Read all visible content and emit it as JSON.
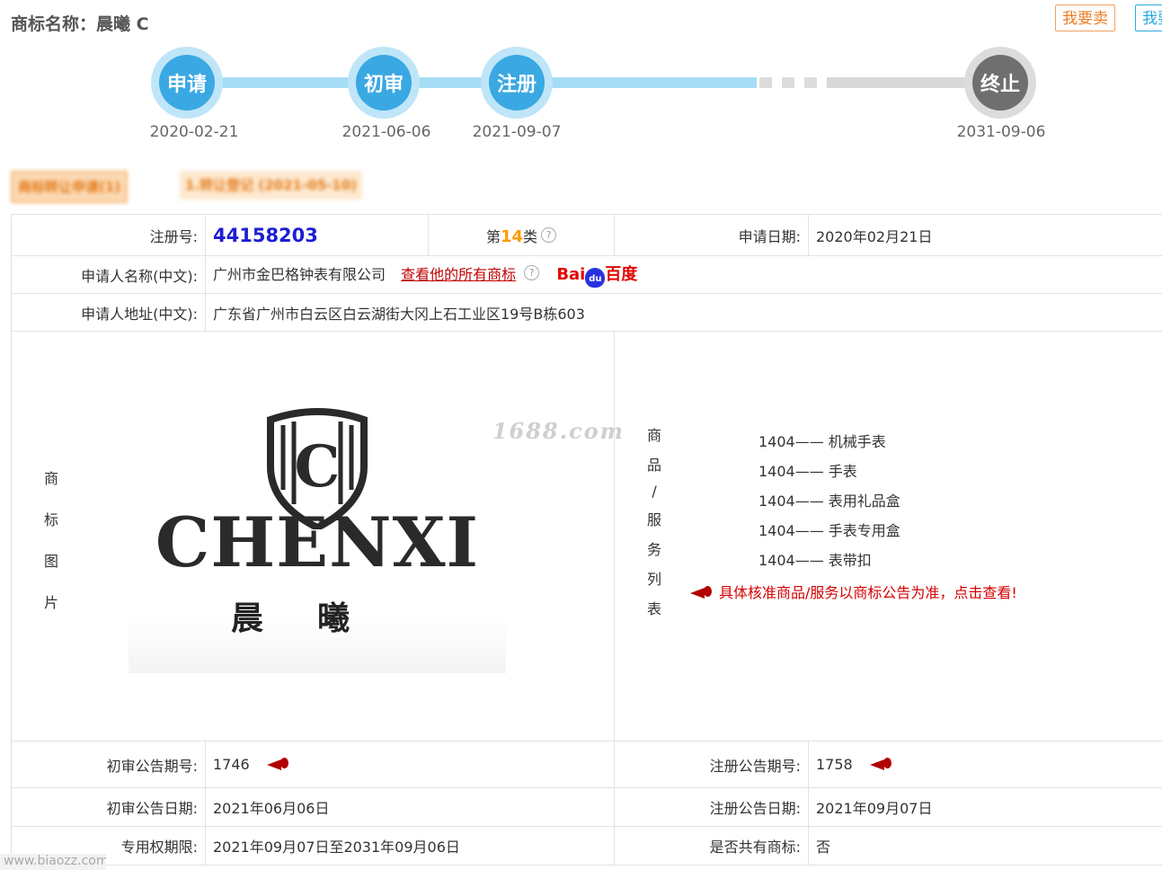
{
  "header": {
    "title": "商标名称：晨曦 C",
    "sell_button": "我要卖",
    "buy_button": "我要买"
  },
  "timeline": {
    "steps": [
      {
        "label": "申请",
        "date": "2020-02-21"
      },
      {
        "label": "初审",
        "date": "2021-06-06"
      },
      {
        "label": "注册",
        "date": "2021-09-07"
      },
      {
        "label": "终止",
        "date": "2031-09-06"
      }
    ]
  },
  "notice_tags": {
    "tag1": "商标转让申请(1)",
    "tag2": "1.转让登记 (2021-05-10)"
  },
  "info": {
    "reg_no_label": "注册号:",
    "reg_no": "44158203",
    "class_prefix": "第",
    "class_num": "14",
    "class_suffix": "类",
    "apply_date_label": "申请日期:",
    "apply_date": "2020年02月21日",
    "applicant_label": "申请人名称(中文):",
    "applicant": "广州市金巴格钟表有限公司",
    "view_all_link": "查看他的所有商标",
    "baidu_text1": "Bai",
    "baidu_paw": "du",
    "baidu_text2": "百度",
    "address_label": "申请人地址(中文):",
    "address": "广东省广州市白云区白云湖街大冈上石工业区19号B栋603",
    "image_label_chars": [
      "商",
      "标",
      "图",
      "片"
    ],
    "logo_word": "CHENXI",
    "logo_cn": "晨曦",
    "watermark": "1688.com",
    "goods_label_chars": [
      "商",
      "品",
      "/",
      "服",
      "务",
      "列",
      "表"
    ],
    "goods": [
      "1404—— 机械手表",
      "1404—— 手表",
      "1404—— 表用礼品盒",
      "1404—— 手表专用盒",
      "1404—— 表带扣"
    ],
    "goods_note": "具体核准商品/服务以商标公告为准，点击查看!",
    "prelim_no_label": "初审公告期号:",
    "prelim_no": "1746",
    "reg_pub_no_label": "注册公告期号:",
    "reg_pub_no": "1758",
    "prelim_date_label": "初审公告日期:",
    "prelim_date": "2021年06月06日",
    "reg_pub_date_label": "注册公告日期:",
    "reg_pub_date": "2021年09月07日",
    "exclusive_label": "专用权期限:",
    "exclusive": "2021年09月07日至2031年09月06日",
    "shared_label": "是否共有商标:",
    "shared": "否"
  },
  "footer": {
    "url": "www.biaozz.com"
  },
  "colors": {
    "timeline_active": "#3aa8e2",
    "timeline_ended": "#6f6f6f",
    "reg_no": "#1c1ed1",
    "class_num": "#ff9900",
    "alert_red": "#d40000"
  },
  "icons": [
    "help-icon",
    "megaphone-icon",
    "baidu-logo"
  ]
}
